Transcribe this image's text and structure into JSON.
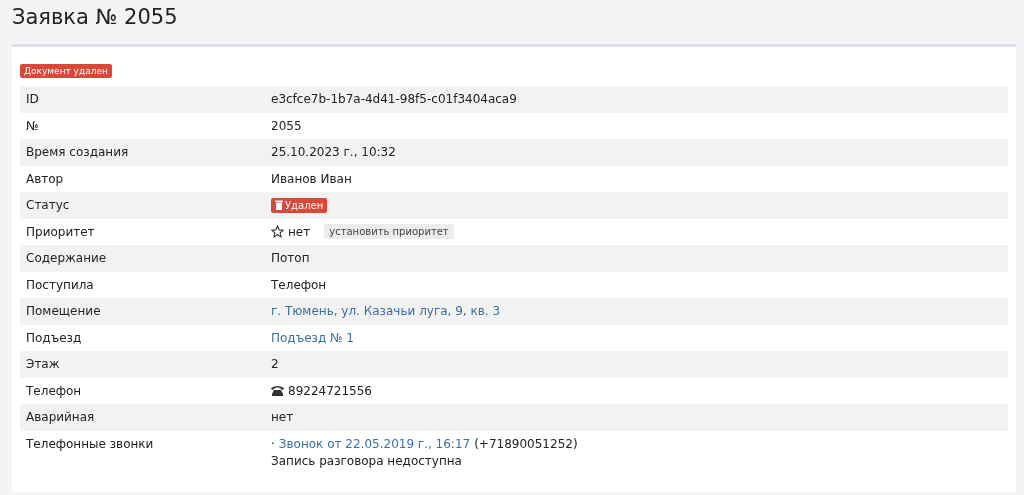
{
  "title": "Заявка № 2055",
  "deleted_badge": "Документ удален",
  "rows": [
    {
      "label": "ID",
      "kind": "text",
      "value": "e3cfce7b-1b7a-4d41-98f5-c01f3404aca9"
    },
    {
      "label": "№",
      "kind": "text",
      "value": "2055"
    },
    {
      "label": "Время создания",
      "kind": "text",
      "value": "25.10.2023 г., 10:32"
    },
    {
      "label": "Автор",
      "kind": "text",
      "value": "Иванов Иван"
    },
    {
      "label": "Статус",
      "kind": "status",
      "value": "Удален"
    },
    {
      "label": "Приоритет",
      "kind": "priority",
      "value": "нет",
      "action": "установить приоритет"
    },
    {
      "label": "Содержание",
      "kind": "text",
      "value": "Потоп"
    },
    {
      "label": "Поступила",
      "kind": "text",
      "value": "Телефон"
    },
    {
      "label": "Помещение",
      "kind": "link",
      "value": "г. Тюмень, ул. Казачьи луга, 9, кв. 3"
    },
    {
      "label": "Подъезд",
      "kind": "link",
      "value": "Подъезд № 1"
    },
    {
      "label": "Этаж",
      "kind": "text",
      "value": "2"
    },
    {
      "label": "Телефон",
      "kind": "phone",
      "value": "89224721556"
    },
    {
      "label": "Аварийная",
      "kind": "text",
      "value": "нет"
    },
    {
      "label": "Телефонные звонки",
      "kind": "calls",
      "bullet": "·",
      "link": "Звонок от 22.05.2019 г., 16:17",
      "number": "(+71890051252)",
      "note": "Запись разговора недоступна"
    }
  ]
}
